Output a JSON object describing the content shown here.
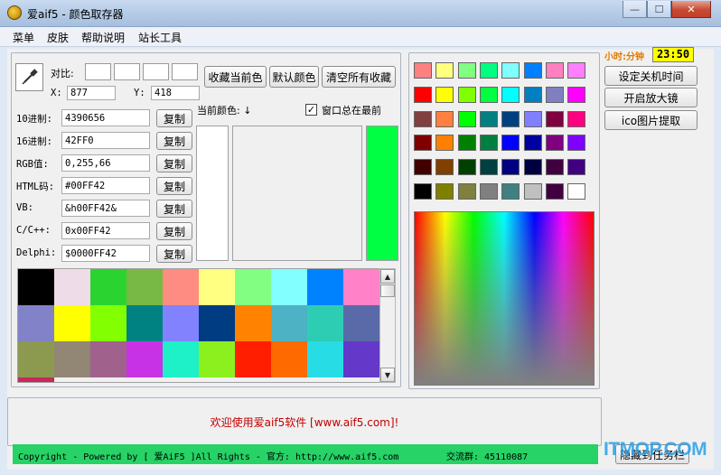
{
  "window": {
    "title": "爱aif5 - 颜色取存器",
    "minimize_glyph": "—",
    "maximize_glyph": "☐",
    "close_glyph": "✕"
  },
  "menu": [
    "菜单",
    "皮肤",
    "帮助说明",
    "站长工具"
  ],
  "picker": {
    "compare_label": "对比:",
    "x_label": "X:",
    "x_value": "877",
    "y_label": "Y:",
    "y_value": "418"
  },
  "actions": {
    "save_current": "收藏当前色",
    "default_colors": "默认颜色",
    "clear_saved": "清空所有收藏"
  },
  "formats": [
    {
      "label": "10进制:",
      "value": "4390656",
      "copy": "复制"
    },
    {
      "label": "16进制:",
      "value": "42FF0",
      "copy": "复制"
    },
    {
      "label": "RGB值:",
      "value": "0,255,66",
      "copy": "复制"
    },
    {
      "label": "HTML码:",
      "value": "#00FF42",
      "copy": "复制"
    },
    {
      "label": "VB:",
      "value": "&h00FF42&",
      "copy": "复制"
    },
    {
      "label": "C/C++:",
      "value": "0x00FF42",
      "copy": "复制"
    },
    {
      "label": "Delphi:",
      "value": "$0000FF42",
      "copy": "复制"
    }
  ],
  "current_color": {
    "label": "当前颜色: ↓",
    "hex": "#00FF42"
  },
  "always_on_top": {
    "label": "窗口总在最前",
    "checked": true,
    "check_glyph": "✓"
  },
  "saved_colors": [
    "#000000",
    "#EEDDE8",
    "#2BD331",
    "#78B845",
    "#FF8C82",
    "#FFFF82",
    "#82FF82",
    "#82FFFF",
    "#0082FF",
    "#FF82C8",
    "#8282C8",
    "#FFFF00",
    "#82FF00",
    "#008282",
    "#8282FF",
    "#003C82",
    "#FF8200",
    "#4CB2C4",
    "#2DCDB4",
    "#5A6AA8",
    "#8C9A50",
    "#928674",
    "#A0628C",
    "#C832E6",
    "#1EF0C8",
    "#8CF01E",
    "#FF1E00",
    "#FF6A00",
    "#28DCE6",
    "#6438C8"
  ],
  "palette": [
    "#FF8080",
    "#FFFF80",
    "#80FF80",
    "#00FF80",
    "#80FFFF",
    "#0080FF",
    "#FF80C0",
    "#FF80FF",
    "#FF0000",
    "#FFFF00",
    "#80FF00",
    "#00FF40",
    "#00FFFF",
    "#0080C0",
    "#8080C0",
    "#FF00FF",
    "#804040",
    "#FF8040",
    "#00FF00",
    "#008080",
    "#004080",
    "#8080FF",
    "#800040",
    "#FF0080",
    "#800000",
    "#FF8000",
    "#008000",
    "#008040",
    "#0000FF",
    "#0000A0",
    "#800080",
    "#8000FF",
    "#400000",
    "#804000",
    "#004000",
    "#004040",
    "#000080",
    "#000040",
    "#400040",
    "#400080",
    "#000000",
    "#808000",
    "#808040",
    "#808080",
    "#408080",
    "#C0C0C0",
    "#400040",
    "#FFFFFF"
  ],
  "clock": {
    "label": "小时:分钟",
    "time": "23:50"
  },
  "side_buttons": [
    "设定关机时间",
    "开启放大镜",
    "ico图片提取"
  ],
  "welcome": "欢迎使用爱aif5软件 [www.aif5.com]!",
  "footer": {
    "copyright": "Copyright - Powered by [ 爱AiF5 ]All Rights - 官方: http://www.aif5.com",
    "group": "交流群: 45110087",
    "hide_text": "隐藏到任务栏"
  },
  "watermark": "ITMOP.COM"
}
